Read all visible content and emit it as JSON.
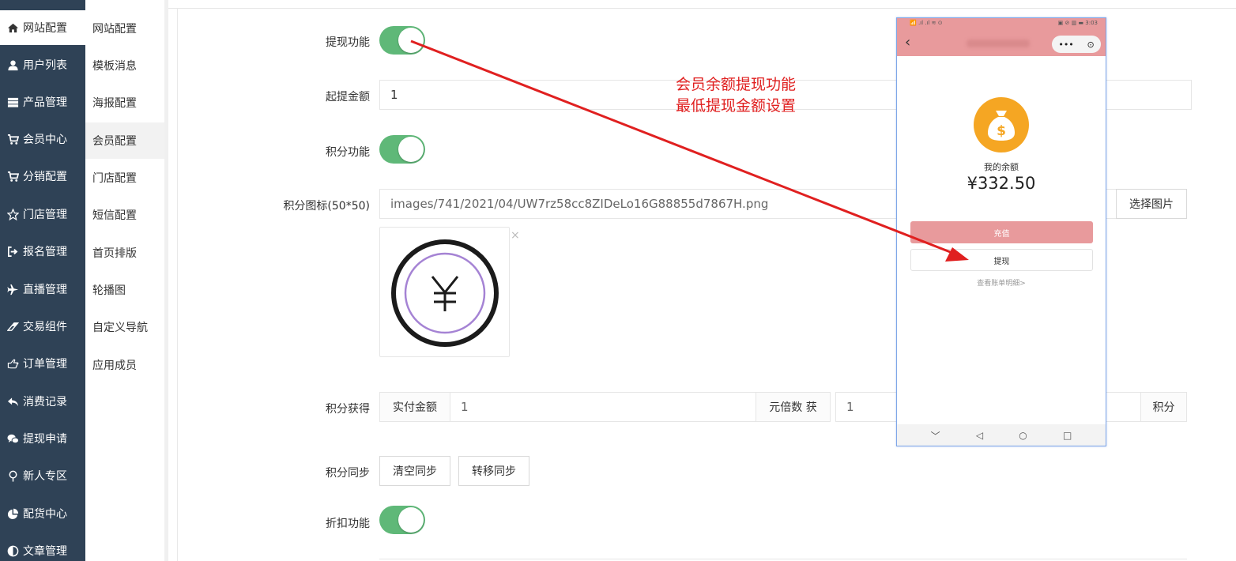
{
  "sidebar_primary": {
    "items": [
      {
        "label": "网站配置",
        "icon": "home-icon"
      },
      {
        "label": "用户列表",
        "icon": "user-icon"
      },
      {
        "label": "产品管理",
        "icon": "server-icon"
      },
      {
        "label": "会员中心",
        "icon": "cart-icon"
      },
      {
        "label": "分销配置",
        "icon": "cart-icon"
      },
      {
        "label": "门店管理",
        "icon": "star-icon"
      },
      {
        "label": "报名管理",
        "icon": "sign-out-icon"
      },
      {
        "label": "直播管理",
        "icon": "plane-icon"
      },
      {
        "label": "交易组件",
        "icon": "eraser-icon"
      },
      {
        "label": "订单管理",
        "icon": "hand-point-icon"
      },
      {
        "label": "消费记录",
        "icon": "reply-icon"
      },
      {
        "label": "提现申请",
        "icon": "wechat-icon"
      },
      {
        "label": "新人专区",
        "icon": "map-pin-icon"
      },
      {
        "label": "配货中心",
        "icon": "pie-chart-icon"
      },
      {
        "label": "文章管理",
        "icon": "half-circle-icon"
      }
    ]
  },
  "sidebar_secondary": {
    "items": [
      "网站配置",
      "模板消息",
      "海报配置",
      "会员配置",
      "门店配置",
      "短信配置",
      "首页排版",
      "轮播图",
      "自定义导航",
      "应用成员"
    ]
  },
  "form": {
    "withdraw": {
      "label": "提现功能",
      "enabled": true
    },
    "min_amount": {
      "label": "起提金额",
      "value": "1"
    },
    "points": {
      "label": "积分功能",
      "enabled": true
    },
    "points_icon": {
      "label": "积分图标(50*50)",
      "value": "images/741/2021/04/UW7rz58cc8ZIDeLo16G88855d7867H.png",
      "button": "选择图片",
      "close": "×"
    },
    "points_earn": {
      "label": "积分获得",
      "prefix": "实付金额",
      "value1": "1",
      "middle": "元倍数 获",
      "value2": "1",
      "suffix": "积分"
    },
    "points_sync": {
      "label": "积分同步",
      "btn_clear": "清空同步",
      "btn_transfer": "转移同步"
    },
    "discount": {
      "label": "折扣功能",
      "enabled": true
    }
  },
  "annotation": {
    "line1": "会员余额提现功能",
    "line2": "最低提现金额设置",
    "color": "#e02020"
  },
  "phone": {
    "status_left": "📶 .ıl .ıl ≋ ⊙",
    "status_right": "▣ ⊘ ▥ ▬ 3:03",
    "back": "‹",
    "caps_more": "•••",
    "caps_close": "⊙",
    "balance_label": "我的余额",
    "balance_value": "¥332.50",
    "btn_recharge": "充值",
    "btn_withdraw": "提现",
    "link_detail": "查看账单明细>",
    "nav": [
      "﹀",
      "◁",
      "○",
      "□"
    ],
    "theme_color": "#e89a9c"
  }
}
